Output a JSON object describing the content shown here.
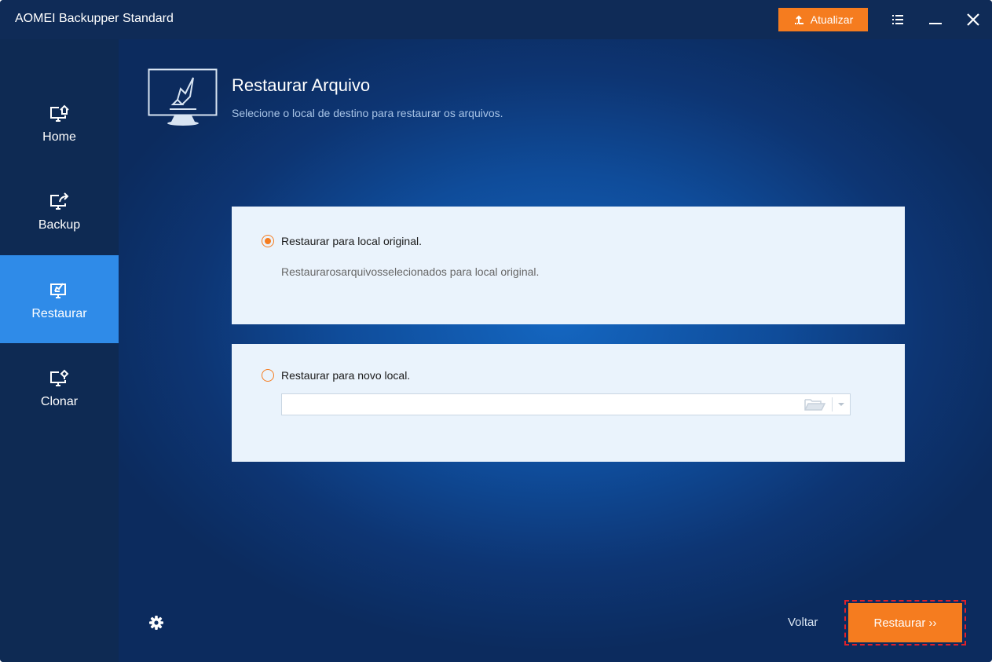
{
  "app": {
    "title": "AOMEI Backupper Standard"
  },
  "titlebar": {
    "upgrade_label": "Atualizar"
  },
  "sidebar": {
    "items": [
      {
        "label": "Home",
        "icon": "home-monitor-icon"
      },
      {
        "label": "Backup",
        "icon": "backup-monitor-icon"
      },
      {
        "label": "Restaurar",
        "icon": "restore-monitor-icon",
        "active": true
      },
      {
        "label": "Clonar",
        "icon": "clone-monitor-icon"
      }
    ]
  },
  "page": {
    "title": "Restaurar Arquivo",
    "subtitle": "Selecione o local de destino para restaurar os arquivos."
  },
  "options": {
    "original": {
      "label": "Restaurar para local original.",
      "description": "Restaurarosarquivosselecionados para local original.",
      "selected": true
    },
    "new_location": {
      "label": "Restaurar para novo local.",
      "path_value": "",
      "selected": false
    }
  },
  "footer": {
    "back_label": "Voltar",
    "restore_label": "Restaurar ››"
  },
  "colors": {
    "accent": "#f57c1f",
    "active_nav": "#2f8be8",
    "highlight_frame": "#e0202a"
  }
}
